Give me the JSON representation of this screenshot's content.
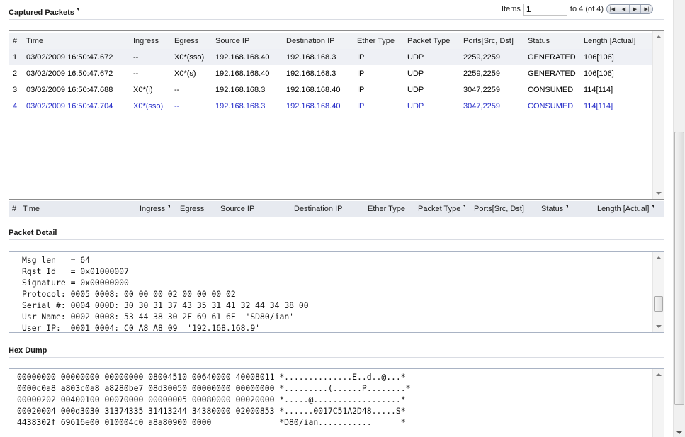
{
  "captured": {
    "title": "Captured Packets",
    "pager": {
      "items_label": "Items",
      "items_value": "1",
      "range_text": "to 4 (of 4)",
      "buttons": [
        "first-page",
        "prev-page",
        "next-page",
        "last-page"
      ]
    },
    "columns": [
      "#",
      "Time",
      "Ingress",
      "Egress",
      "Source IP",
      "Destination IP",
      "Ether Type",
      "Packet Type",
      "Ports[Src, Dst]",
      "Status",
      "Length [Actual]"
    ],
    "rows": [
      {
        "num": "1",
        "time": "03/02/2009 16:50:47.672",
        "ingress": "--",
        "egress": "X0*(sso)",
        "src": "192.168.168.40",
        "dst": "192.168.168.3",
        "ether": "IP",
        "ptype": "UDP",
        "ports": "2259,2259",
        "status": "GENERATED",
        "length": "106[106]"
      },
      {
        "num": "2",
        "time": "03/02/2009 16:50:47.672",
        "ingress": "--",
        "egress": "X0*(s)",
        "src": "192.168.168.40",
        "dst": "192.168.168.3",
        "ether": "IP",
        "ptype": "UDP",
        "ports": "2259,2259",
        "status": "GENERATED",
        "length": "106[106]"
      },
      {
        "num": "3",
        "time": "03/02/2009 16:50:47.688",
        "ingress": "X0*(i)",
        "egress": "--",
        "src": "192.168.168.3",
        "dst": "192.168.168.40",
        "ether": "IP",
        "ptype": "UDP",
        "ports": "3047,2259",
        "status": "CONSUMED",
        "length": "114[114]"
      },
      {
        "num": "4",
        "time": "03/02/2009 16:50:47.704",
        "ingress": "X0*(sso)",
        "egress": "--",
        "src": "192.168.168.3",
        "dst": "192.168.168.40",
        "ether": "IP",
        "ptype": "UDP",
        "ports": "3047,2259",
        "status": "CONSUMED",
        "length": "114[114]"
      }
    ],
    "selected_row_color": "#2229c8",
    "footer_columns": [
      "#",
      "Time",
      "Ingress",
      "Egress",
      "Source IP",
      "Destination IP",
      "Ether Type",
      "Packet Type",
      "Ports[Src, Dst]",
      "Status",
      "Length [Actual]"
    ]
  },
  "detail": {
    "title": "Packet Detail",
    "lines": [
      "Msg len   = 64",
      "Rqst Id   = 0x01000007",
      "Signature = 0x00000000",
      "Protocol: 0005 0008: 00 00 00 02 00 00 00 02",
      "Serial #: 0004 000D: 30 30 31 37 43 35 31 41 32 44 34 38 00",
      "Usr Name: 0002 0008: 53 44 38 30 2F 69 61 6E  'SD80/ian'",
      "User IP:  0001 0004: C0 A8 A8 09  '192.168.168.9'"
    ]
  },
  "hexdump": {
    "title": "Hex Dump",
    "lines": [
      "00000000 00000000 00000000 08004510 00640000 40008011 *..............E..d..@...*",
      "0000c0a8 a803c0a8 a8280be7 08d30050 00000000 00000000 *.........(......P........*",
      "00000202 00400100 00070000 00000005 00080000 00020000 *.....@..................*",
      "00020004 000d3030 31374335 31413244 34380000 02000853 *......0017C51A2D48.....S*",
      "4438302f 69616e00 010004c0 a8a80900 0000              *D80/ian...........      *"
    ]
  }
}
